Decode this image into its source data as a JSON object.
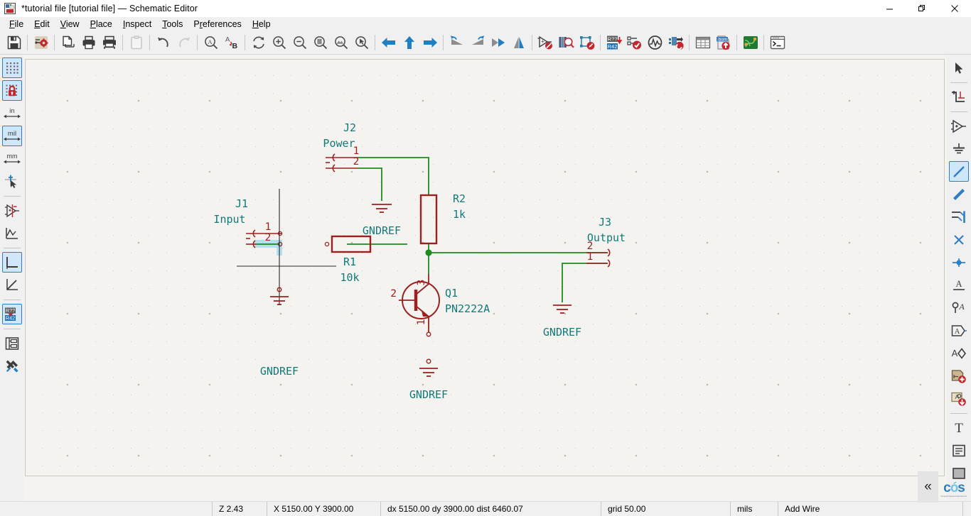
{
  "window": {
    "title": "*tutorial file [tutorial file] — Schematic Editor",
    "app_icon": "kicad-eeschema-icon",
    "minimize": "—",
    "maximize": "❐",
    "close": "✕"
  },
  "menubar": {
    "items": [
      {
        "label": "File",
        "mnemonic": "F"
      },
      {
        "label": "Edit",
        "mnemonic": "E"
      },
      {
        "label": "View",
        "mnemonic": "V"
      },
      {
        "label": "Place",
        "mnemonic": "P"
      },
      {
        "label": "Inspect",
        "mnemonic": "I"
      },
      {
        "label": "Tools",
        "mnemonic": "T"
      },
      {
        "label": "Preferences",
        "mnemonic": "r"
      },
      {
        "label": "Help",
        "mnemonic": "H"
      }
    ]
  },
  "toolbar": {
    "items": [
      {
        "name": "save-icon",
        "tip": "Save"
      },
      {
        "sep": true
      },
      {
        "name": "page-settings-icon",
        "tip": "Page settings"
      },
      {
        "sep": true
      },
      {
        "name": "print-preview-icon",
        "tip": "Print preview"
      },
      {
        "name": "print-icon",
        "tip": "Print"
      },
      {
        "name": "plot-icon",
        "tip": "Plot"
      },
      {
        "sep": true
      },
      {
        "name": "paste-icon",
        "tip": "Paste",
        "disabled": true
      },
      {
        "sep": true
      },
      {
        "name": "undo-icon",
        "tip": "Undo"
      },
      {
        "name": "redo-icon",
        "tip": "Redo",
        "disabled": true
      },
      {
        "sep": true
      },
      {
        "name": "find-icon",
        "tip": "Find"
      },
      {
        "name": "find-replace-icon",
        "tip": "Find and replace"
      },
      {
        "sep": true
      },
      {
        "name": "refresh-icon",
        "tip": "Refresh"
      },
      {
        "name": "zoom-in-icon",
        "tip": "Zoom in"
      },
      {
        "name": "zoom-out-icon",
        "tip": "Zoom out"
      },
      {
        "name": "zoom-fit-page-icon",
        "tip": "Zoom to fit page"
      },
      {
        "name": "zoom-fit-objects-icon",
        "tip": "Zoom to fit objects"
      },
      {
        "name": "zoom-area-icon",
        "tip": "Zoom to selection"
      },
      {
        "sep": true
      },
      {
        "name": "leave-sheet-icon",
        "tip": "Leave sheet"
      },
      {
        "name": "up-sheet-icon",
        "tip": "Go up"
      },
      {
        "name": "enter-sheet-icon",
        "tip": "Enter sheet"
      },
      {
        "sep": true
      },
      {
        "name": "rotate-ccw-icon",
        "tip": "Rotate counterclockwise"
      },
      {
        "name": "rotate-cw-icon",
        "tip": "Rotate clockwise"
      },
      {
        "name": "mirror-vertical-icon",
        "tip": "Mirror vertically"
      },
      {
        "name": "mirror-horizontal-icon",
        "tip": "Mirror horizontally"
      },
      {
        "sep": true
      },
      {
        "name": "show-hidden-pins-icon",
        "tip": "Show hidden pins"
      },
      {
        "name": "symbol-library-browser-icon",
        "tip": "Symbol library browser"
      },
      {
        "name": "symbol-editor-icon",
        "tip": "Symbol editor"
      },
      {
        "sep": true
      },
      {
        "name": "annotate-icon",
        "tip": "Annotate schematic",
        "label_top": "R??",
        "label_bottom": "R42"
      },
      {
        "name": "erc-icon",
        "tip": "Electrical rules checker"
      },
      {
        "name": "simulator-icon",
        "tip": "Simulator"
      },
      {
        "name": "assign-footprints-icon",
        "tip": "Assign footprints"
      },
      {
        "sep": true
      },
      {
        "name": "bom-table-icon",
        "tip": "Bill of materials"
      },
      {
        "name": "export-netlist-icon",
        "tip": "Export netlist",
        "label": ".bom"
      },
      {
        "sep": true
      },
      {
        "name": "open-pcb-editor-icon",
        "tip": "Open PCB editor"
      },
      {
        "sep": true
      },
      {
        "name": "scripting-console-icon",
        "tip": "Scripting console"
      }
    ]
  },
  "left_toolbar": {
    "items": [
      {
        "name": "toggle-grid-icon",
        "tip": "Show grid",
        "active": true
      },
      {
        "name": "grid-lock-icon",
        "tip": "Snap to grid",
        "active": true
      },
      {
        "sep": false
      },
      {
        "name": "units-inches-icon",
        "label": "in",
        "tip": "Inches"
      },
      {
        "name": "units-mils-icon",
        "label": "mil",
        "tip": "Mils",
        "active": true
      },
      {
        "name": "units-millimeters-icon",
        "label": "mm",
        "tip": "Millimeters"
      },
      {
        "sep": false
      },
      {
        "name": "cursor-fullscreen-icon",
        "tip": "Full-window crosshair"
      },
      {
        "sep": true
      },
      {
        "name": "show-hidden-pins-left-icon",
        "tip": "Show hidden pins"
      },
      {
        "name": "show-erc-warnings-icon",
        "tip": "Show ERC warnings"
      },
      {
        "sep": true
      },
      {
        "name": "wire-90deg-icon",
        "tip": "Lines drawn at any angle (H/V)",
        "active": true
      },
      {
        "name": "wire-any-angle-icon",
        "tip": "Lines drawn at any angle"
      },
      {
        "sep": true
      },
      {
        "name": "annotate-left-icon",
        "tip": "Annotate",
        "label_top": "R??",
        "label_bottom": "R42",
        "active": true
      },
      {
        "sep": true
      },
      {
        "name": "hierarchy-navigator-icon",
        "tip": "Show hierarchy navigator"
      },
      {
        "name": "properties-manager-icon",
        "tip": "Show properties manager"
      }
    ]
  },
  "right_toolbar": {
    "items": [
      {
        "name": "select-tool-icon",
        "tip": "Selection tool"
      },
      {
        "sep": true
      },
      {
        "name": "highlight-net-icon",
        "tip": "Highlight net"
      },
      {
        "sep": true
      },
      {
        "name": "add-symbol-icon",
        "tip": "Add a symbol"
      },
      {
        "name": "add-power-icon",
        "tip": "Add a power port"
      },
      {
        "sep": false
      },
      {
        "name": "add-wire-icon",
        "tip": "Add a wire",
        "active": true
      },
      {
        "name": "add-bus-icon",
        "tip": "Add a bus"
      },
      {
        "name": "add-wire-to-bus-entry-icon",
        "tip": "Add wire to bus entry"
      },
      {
        "name": "add-no-connect-icon",
        "tip": "Add a no-connect flag"
      },
      {
        "name": "add-junction-icon",
        "tip": "Add a junction"
      },
      {
        "sep": false
      },
      {
        "name": "add-net-label-icon",
        "tip": "Add a net label"
      },
      {
        "name": "add-net-class-directive-icon",
        "tip": "Add a net class directive"
      },
      {
        "name": "add-hierarchical-label-icon",
        "tip": "Add a hierarchical label"
      },
      {
        "name": "add-global-label-icon",
        "tip": "Add a global label"
      },
      {
        "name": "add-hierarchical-sheet-icon",
        "tip": "Add a hierarchical sheet"
      },
      {
        "name": "import-sheet-pin-icon",
        "tip": "Import a hierarchical sheet pin"
      },
      {
        "sep": true
      },
      {
        "name": "add-text-icon",
        "tip": "Add text"
      },
      {
        "name": "add-text-box-icon",
        "tip": "Add a text box"
      },
      {
        "name": "add-rectangle-icon",
        "tip": "Draw a rectangle"
      }
    ]
  },
  "statusbar": {
    "zoom": "Z 2.43",
    "position": "X 5150.00  Y 3900.00",
    "relative": "dx 5150.00  dy 3900.00  dist 6460.07",
    "grid": "grid 50.00",
    "units": "mils",
    "tool": "Add Wire",
    "collapse": "«",
    "logo_text": "cos",
    "logo_sub": "Computer Systems Services Inc."
  },
  "schematic": {
    "symbols": [
      {
        "name": "connector-j1",
        "reference": "J1",
        "value": "Input",
        "pins": [
          {
            "number": "1"
          },
          {
            "number": "2"
          }
        ]
      },
      {
        "name": "connector-j2",
        "reference": "J2",
        "value": "Power",
        "pins": [
          {
            "number": "1"
          },
          {
            "number": "2"
          }
        ]
      },
      {
        "name": "connector-j3",
        "reference": "J3",
        "value": "Output",
        "pins": [
          {
            "number": "1"
          },
          {
            "number": "2"
          }
        ]
      },
      {
        "name": "resistor-r1",
        "reference": "R1",
        "value": "10k",
        "pins": []
      },
      {
        "name": "resistor-r2",
        "reference": "R2",
        "value": "1k",
        "pins": []
      },
      {
        "name": "transistor-q1",
        "reference": "Q1",
        "value": "PN2222A",
        "pins": [
          {
            "number": "1"
          },
          {
            "number": "2"
          },
          {
            "number": "3"
          }
        ]
      }
    ],
    "power_ports": [
      {
        "name": "power-gndref-j2",
        "label": "GNDREF"
      },
      {
        "name": "power-gndref-j1",
        "label": "GNDREF"
      },
      {
        "name": "power-gndref-q1",
        "label": "GNDREF"
      },
      {
        "name": "power-gndref-j3",
        "label": "GNDREF"
      }
    ],
    "colors": {
      "wire": "#1f8a1f",
      "symbol": "#9c2020",
      "field_text": "#107a7a",
      "pin_text": "#9c2020",
      "junction": "#1f8a1f",
      "selection_highlight": "#aadcf0",
      "background": "#f4f3ef",
      "grid": "#c9c7c0"
    }
  }
}
